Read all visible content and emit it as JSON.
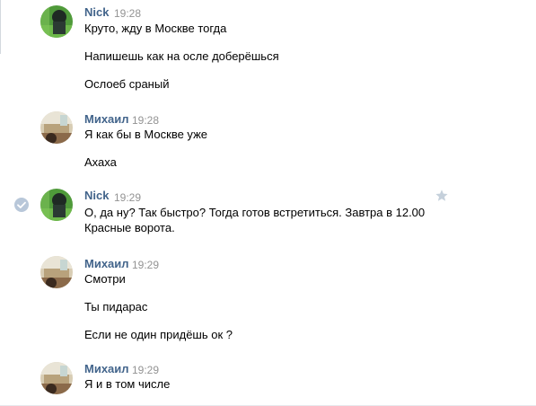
{
  "colors": {
    "author": "#42648b",
    "time": "#939393",
    "text": "#000000",
    "check": "#b8c7d9",
    "star": "#c5d0db"
  },
  "messages": [
    {
      "author": "Nick",
      "time": "19:28",
      "avatar": "nick-avatar",
      "lines": [
        "Круто, жду в Москве тогда",
        "Напишешь как на осле доберёшься",
        "Ослоеб сраный"
      ]
    },
    {
      "author": "Михаил",
      "time": "19:28",
      "avatar": "mikhail-avatar",
      "lines": [
        "Я как бы в Москве уже",
        "Ахаха"
      ]
    },
    {
      "author": "Nick",
      "time": "19:29",
      "avatar": "nick-avatar",
      "selected_icon": "check-circle-icon",
      "favorite_icon": "star-icon",
      "lines": [
        "О, да ну? Так быстро? Тогда готов встретиться. Завтра в 12.00",
        "Красные ворота."
      ]
    },
    {
      "author": "Михаил",
      "time": "19:29",
      "avatar": "mikhail-avatar",
      "lines": [
        "Смотри",
        "Ты пидарас",
        "Если не один придёшь ок ?"
      ]
    },
    {
      "author": "Михаил",
      "time": "19:29",
      "avatar": "mikhail-avatar",
      "lines": [
        "Я и в том числе"
      ]
    }
  ]
}
